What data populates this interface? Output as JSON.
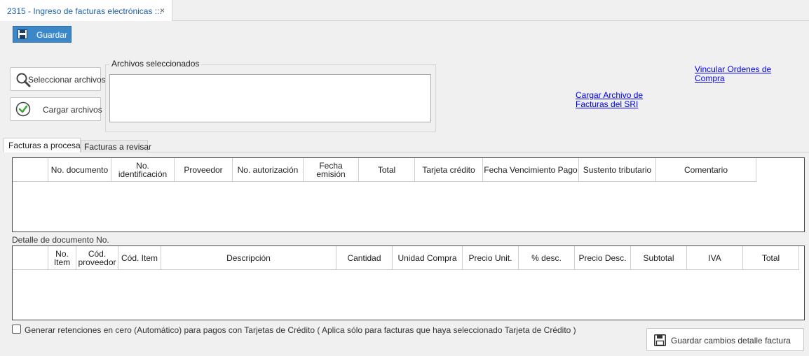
{
  "window_tab": {
    "title": "2315 - Ingreso de facturas electrónicas ::.",
    "close": "×"
  },
  "toolbar": {
    "save_label": "Guardar",
    "save_icon": "floppy-disk-icon"
  },
  "files": {
    "select_label": "Seleccionar archivos",
    "select_icon": "magnifier-icon",
    "load_label": "Cargar archivos",
    "load_icon": "check-circle-icon",
    "group_title": "Archivos seleccionados"
  },
  "links": {
    "sri_line1": "Cargar Archivo de",
    "sri_line2": "Facturas del SRI",
    "oc_line1": "Vincular Ordenes de",
    "oc_line2": "Compra"
  },
  "tabs": [
    {
      "label": "Facturas a procesar",
      "active": true
    },
    {
      "label": "Facturas a revisar",
      "active": false
    }
  ],
  "invoices_grid": {
    "columns": [
      "",
      "No. documento",
      "No. identificación",
      "Proveedor",
      "No. autorización",
      "Fecha emisión",
      "Total",
      "Tarjeta crédito",
      "Fecha Vencimiento Pago",
      "Sustento tributario",
      "Comentario"
    ],
    "rows": []
  },
  "detail": {
    "caption": "Detalle de documento No.",
    "columns": [
      "",
      "No. Item",
      "Cód. proveedor",
      "Cód. Item",
      "Descripción",
      "Cantidad",
      "Unidad Compra",
      "Precio Unit.",
      "% desc.",
      "Precio Desc.",
      "Subtotal",
      "IVA",
      "Total"
    ],
    "rows": []
  },
  "options": {
    "zero_retention_label": "Generar retenciones en cero (Automático) para pagos con Tarjetas de Crédito ( Aplica sólo para facturas que haya seleccionado Tarjeta de Crédito )",
    "zero_retention_checked": false
  },
  "footer": {
    "save_detail_label": "Guardar cambios detalle factura",
    "save_detail_icon": "floppy-disk-icon"
  },
  "colors": {
    "accent": "#3c87c8",
    "link": "#0000ee",
    "tab_title": "#1f5fa8",
    "check_green": "#3aa63a"
  }
}
